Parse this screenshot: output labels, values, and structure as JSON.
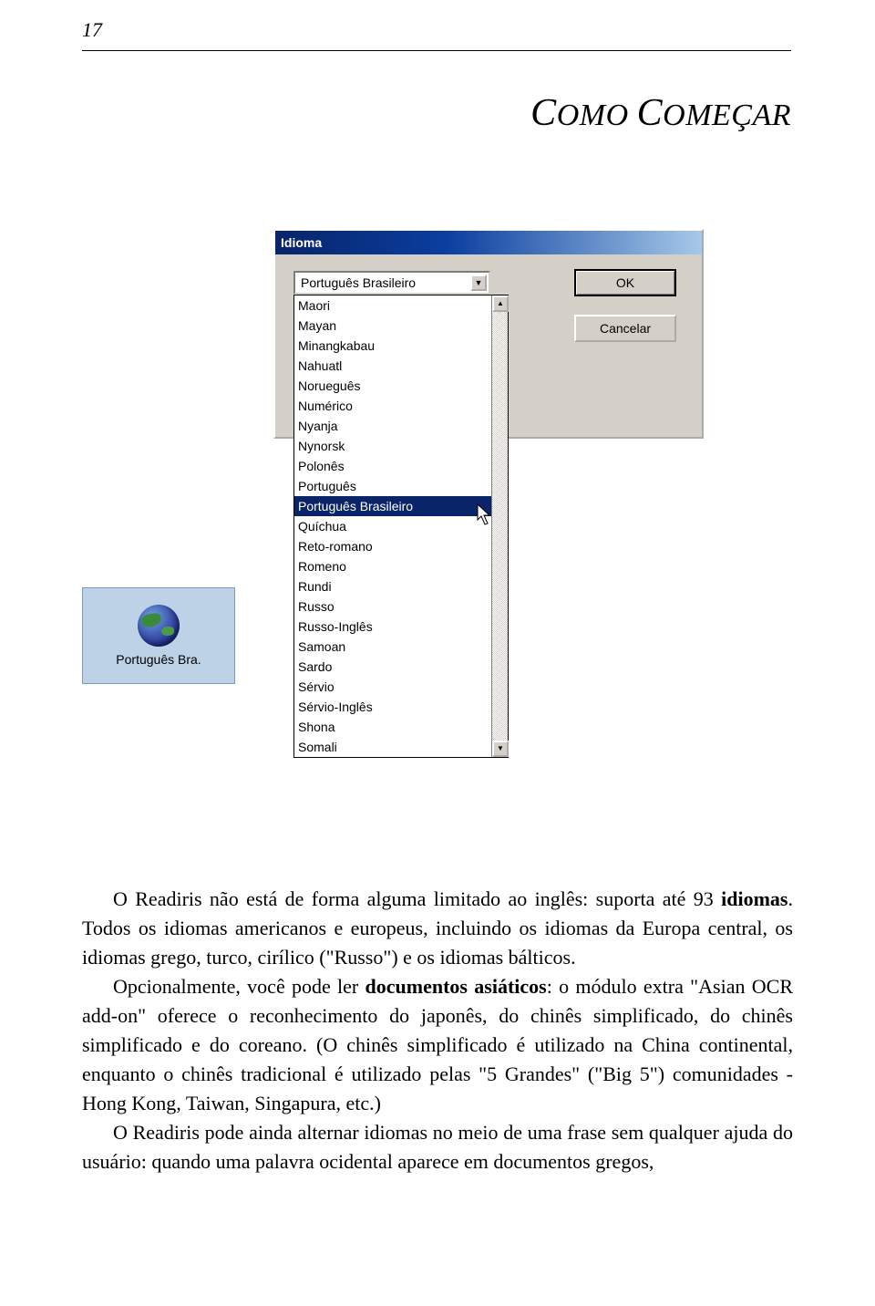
{
  "page_number": "17",
  "chapter": {
    "word1_cap": "C",
    "word1_rest": "OMO",
    "word2_cap": "C",
    "word2_rest": "OMEÇAR"
  },
  "globe_button": {
    "label": "Português Bra."
  },
  "dialog": {
    "title": "Idioma",
    "selected_value": "Português Brasileiro",
    "ok_label": "OK",
    "cancel_label": "Cancelar",
    "options": [
      "Maori",
      "Mayan",
      "Minangkabau",
      "Nahuatl",
      "Norueguês",
      "Numérico",
      "Nyanja",
      "Nynorsk",
      "Polonês",
      "Português",
      "Português Brasileiro",
      "Quíchua",
      "Reto-romano",
      "Romeno",
      "Rundi",
      "Russo",
      "Russo-Inglês",
      "Samoan",
      "Sardo",
      "Sérvio",
      "Sérvio-Inglês",
      "Shona",
      "Somali"
    ],
    "selected_index": 10
  },
  "paragraphs": {
    "p1_a": "O Readiris não está de forma alguma limitado ao inglês: suporta até 93 ",
    "p1_b_bold": "idiomas",
    "p1_c": ". Todos os idiomas americanos e europeus, incluindo os idiomas da Europa central, os idiomas grego, turco, cirílico (\"Russo\") e os idiomas bálticos.",
    "p2_a": "Opcionalmente, você pode ler ",
    "p2_b_bold": "documentos asiáticos",
    "p2_c": ": o módulo extra \"Asian OCR add-on\" oferece o reconhecimento do japonês, do chinês simplificado, do chinês simplificado e do coreano. (O chinês simplificado é utilizado na China continental, enquanto o chinês tradicional é utilizado pelas \"5 Grandes\" (\"Big 5\") comunidades - Hong Kong, Taiwan, Singapura, etc.)",
    "p3": "O Readiris pode ainda alternar idiomas no meio de uma frase sem qualquer ajuda do usuário: quando uma palavra ocidental aparece em documentos gregos,"
  }
}
